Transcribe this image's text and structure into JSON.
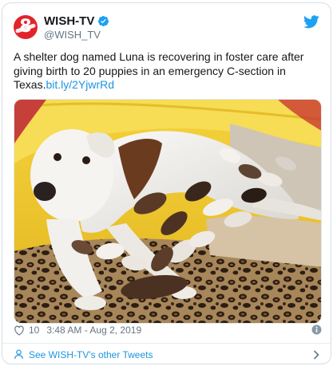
{
  "tweet": {
    "display_name": "WISH-TV",
    "handle": "@WISH_TV",
    "avatar_icon": "wish-tv-8-logo",
    "verified_icon": "verified-badge-icon",
    "platform_icon": "twitter-bird-icon",
    "text_before_link": "A shelter dog named Luna is recovering in foster care after giving birth to 20 puppies in an emergency C-section in Texas.",
    "link_text": "bit.ly/2YjwrRd",
    "likes": "10",
    "timestamp": "3:48 AM - Aug 2, 2019",
    "image_alt": "Luna the white-and-brown dog nursing many newborn puppies on a leopard-print blanket inside a yellow pool"
  },
  "footer": {
    "see_more_label": "See WISH-TV's other Tweets"
  },
  "colors": {
    "link": "#1b95e0",
    "verified": "#1da1f2",
    "brand_red": "#e2242a",
    "muted": "#657786"
  }
}
